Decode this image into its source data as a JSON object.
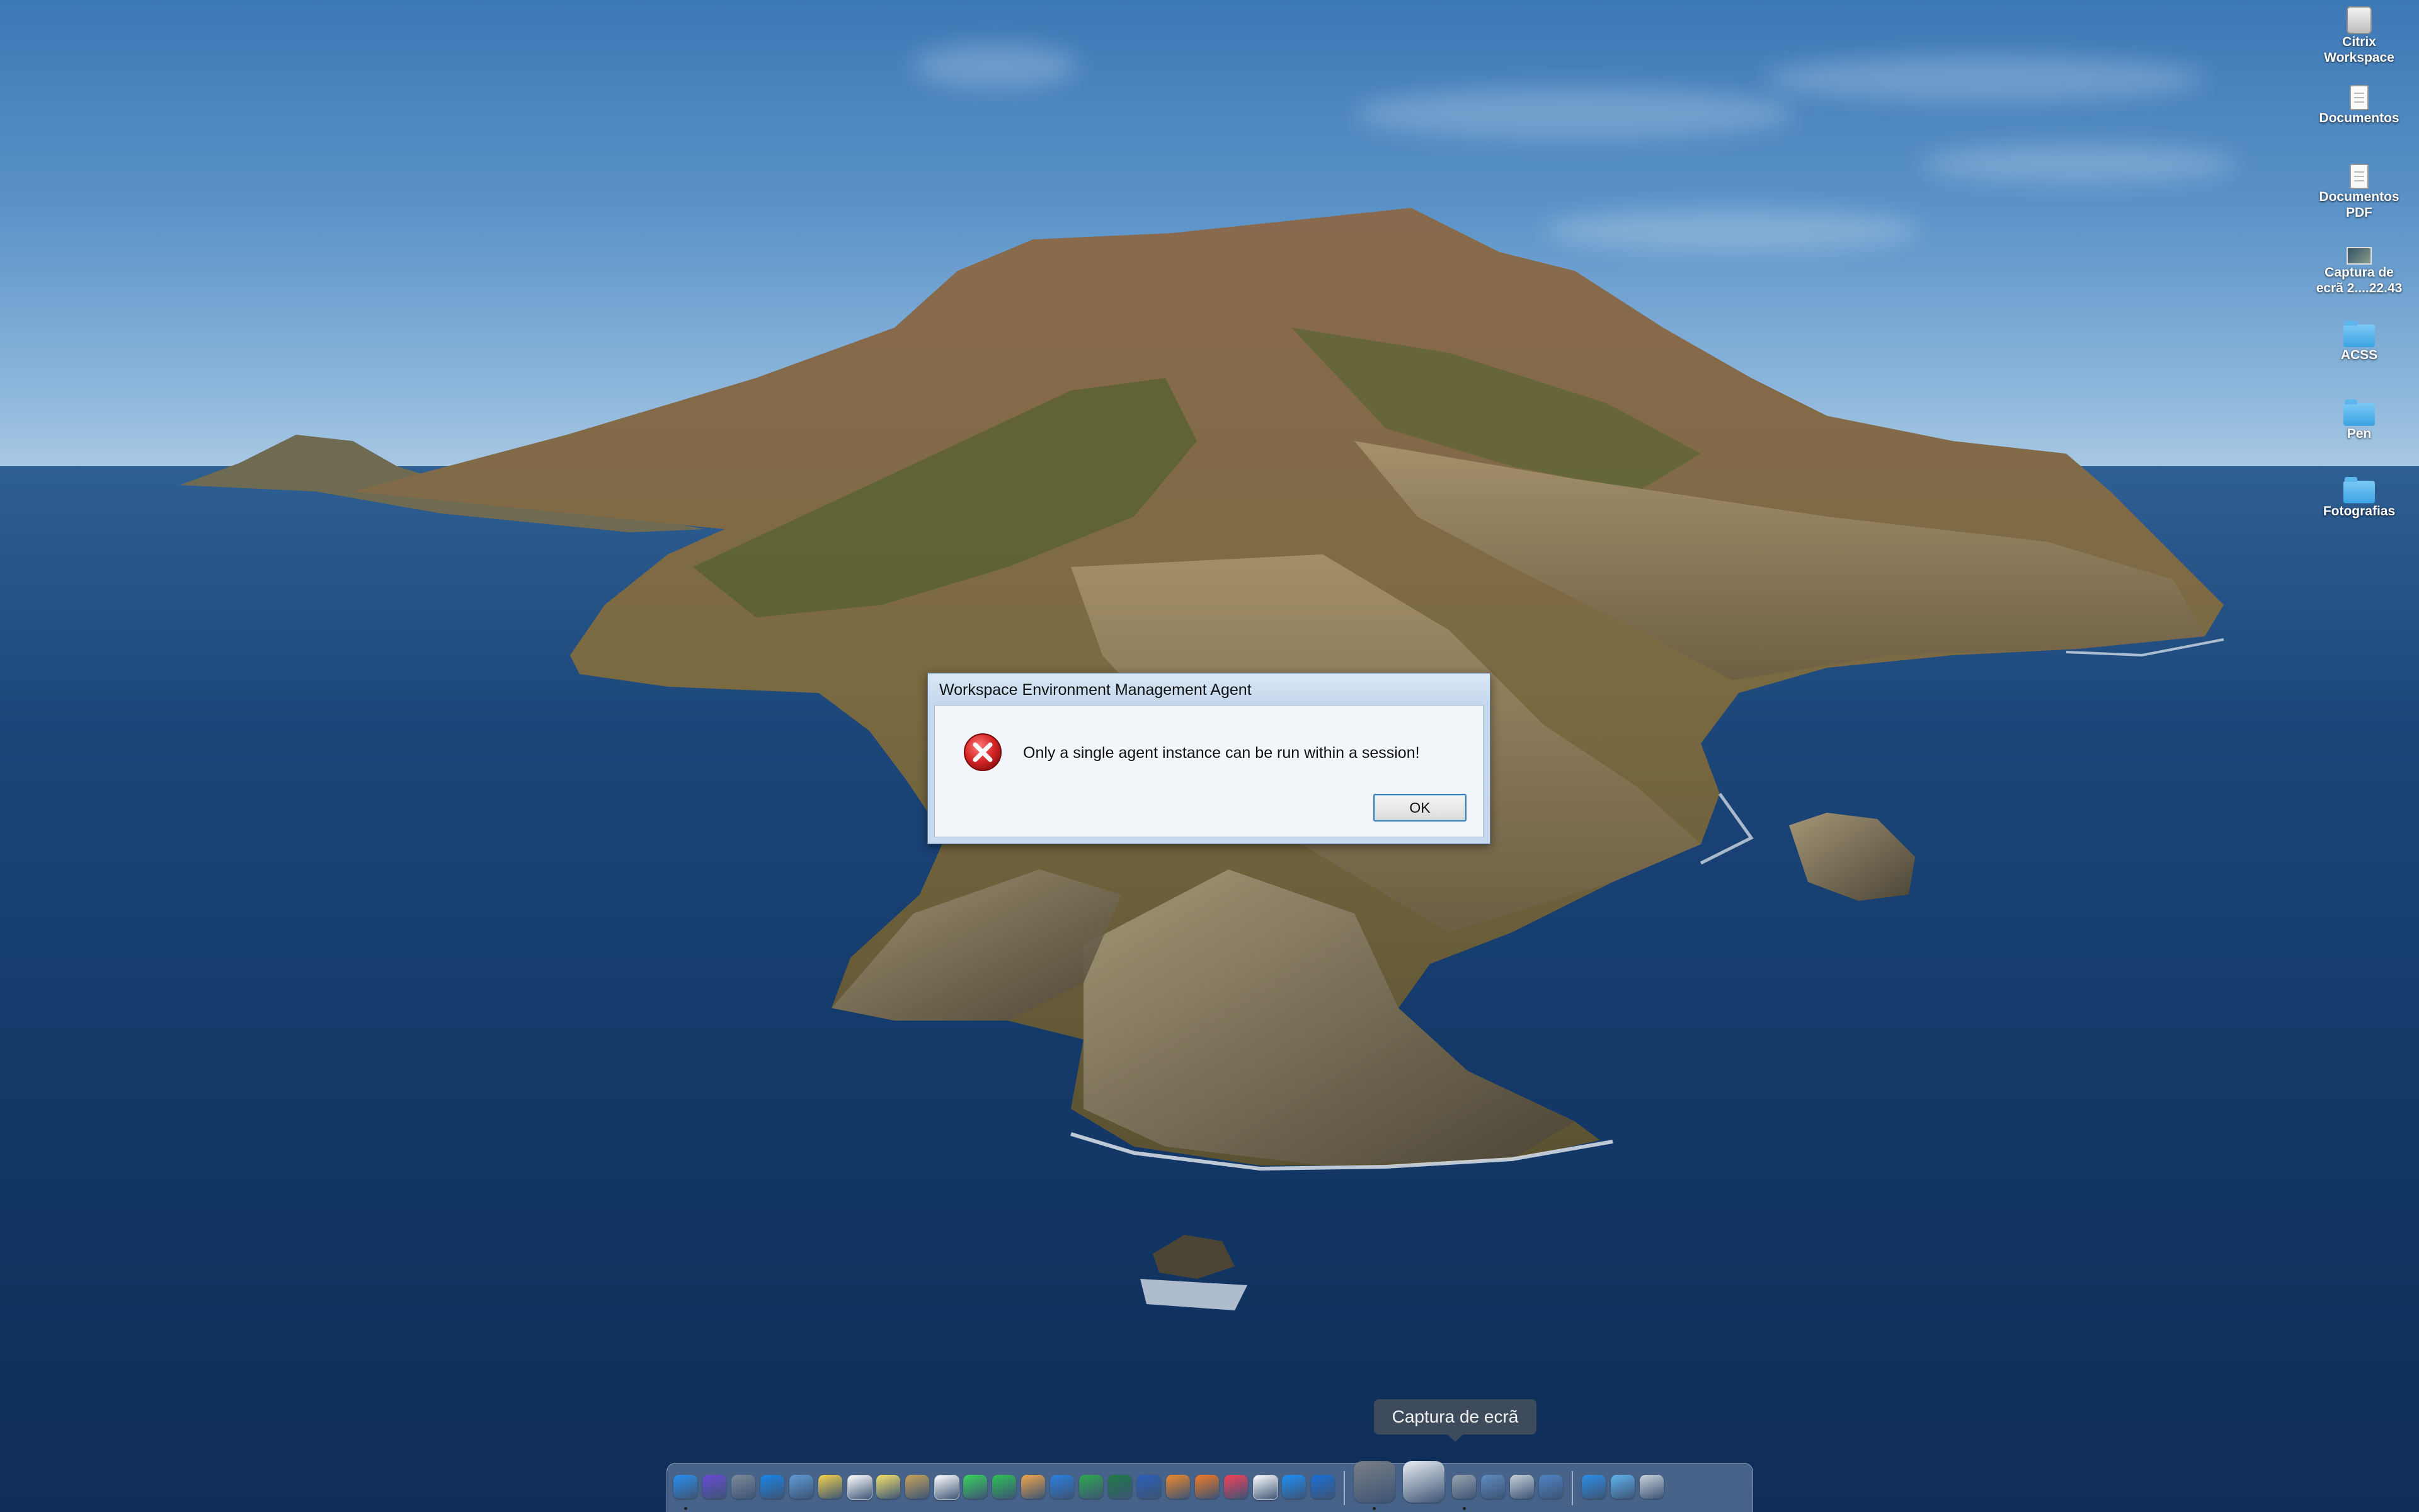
{
  "desktop_icons": [
    {
      "label": "Citrix\nWorkspace",
      "icon": "drive-icon"
    },
    {
      "label": "Documentos",
      "icon": "document-icon"
    },
    {
      "label": "Documentos\nPDF",
      "icon": "document-icon"
    },
    {
      "label": "Captura de\necrã 2....22.43",
      "icon": "screenshot-file-icon"
    },
    {
      "label": "ACSS",
      "icon": "folder-icon"
    },
    {
      "label": "Pen",
      "icon": "folder-icon"
    },
    {
      "label": "Fotografias",
      "icon": "folder-icon"
    }
  ],
  "dialog": {
    "title": "Workspace Environment Management Agent",
    "message": "Only a single agent instance can be run within a session!",
    "icon": "error-icon",
    "ok_label": "OK"
  },
  "dock": {
    "tooltip": "Captura de ecrã",
    "apps": [
      "finder-icon",
      "siri-icon",
      "launchpad-icon",
      "safari-icon",
      "preview-icon",
      "notes-icon",
      "calendar-icon",
      "stickies-icon",
      "contacts-icon",
      "reminders-icon",
      "messages-icon",
      "facetime-icon",
      "photos-icon",
      "keynote-icon",
      "numbers-icon",
      "excel-icon",
      "word-icon",
      "pages-icon",
      "books-icon",
      "music-icon",
      "textedit-icon",
      "app-store-icon",
      "onedrive-icon",
      "system-preferences-icon",
      "screenshot-icon",
      "keychain-icon",
      "image-capture-icon",
      "disk-utility-icon",
      "network-utility-icon",
      "downloads-icon",
      "folder-icon",
      "trash-icon"
    ]
  },
  "colors": {
    "dialog_frame": "#c6d9ee",
    "dialog_body": "#f2f5f9",
    "error_red": "#d42424",
    "tooltip_bg": "#3d4b5c"
  }
}
